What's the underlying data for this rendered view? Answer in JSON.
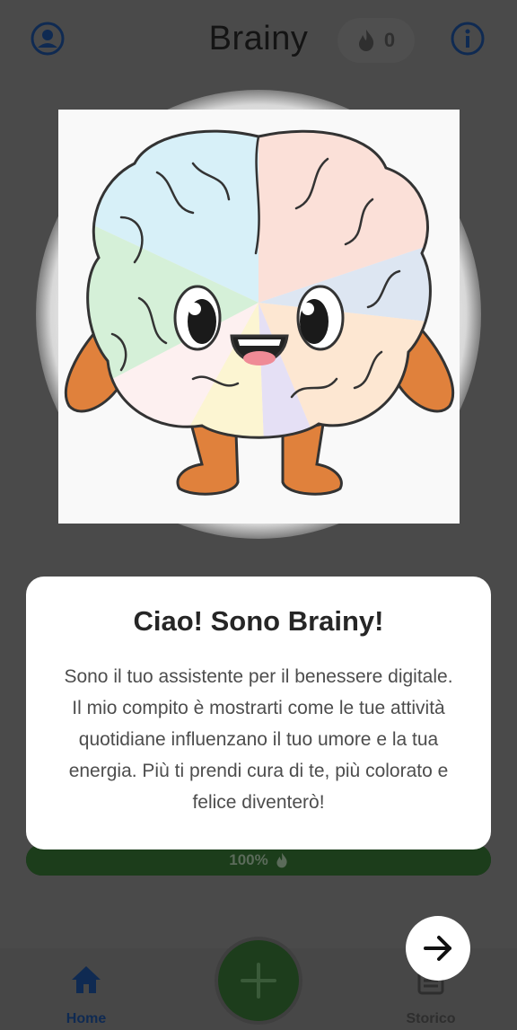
{
  "header": {
    "title": "Brainy",
    "streak_count": "0",
    "profile_icon": "profile-icon",
    "info_icon": "info-icon",
    "streak_icon": "flame-icon"
  },
  "mascot": {
    "icon": "brainy-brain-mascot"
  },
  "dialog": {
    "title": "Ciao! Sono Brainy!",
    "body": "Sono il tuo assistente per il benessere digitale. Il mio compito è mostrarti come le tue attività quotidiane influenzano il tuo umore e la tua energia. Più ti prendi cura di te, più colorato e felice diventerò!"
  },
  "progress": {
    "label": "100%",
    "value": 1.0,
    "icon": "flame-icon"
  },
  "next_button": {
    "icon": "arrow-right-icon"
  },
  "bottom_nav": {
    "home_label": "Home",
    "history_label": "Storico",
    "fab_icon": "plus-icon"
  },
  "colors": {
    "accent_blue": "#0f2a52",
    "fab_green": "#1d3d1c",
    "overlay": "#4a4a4a"
  }
}
